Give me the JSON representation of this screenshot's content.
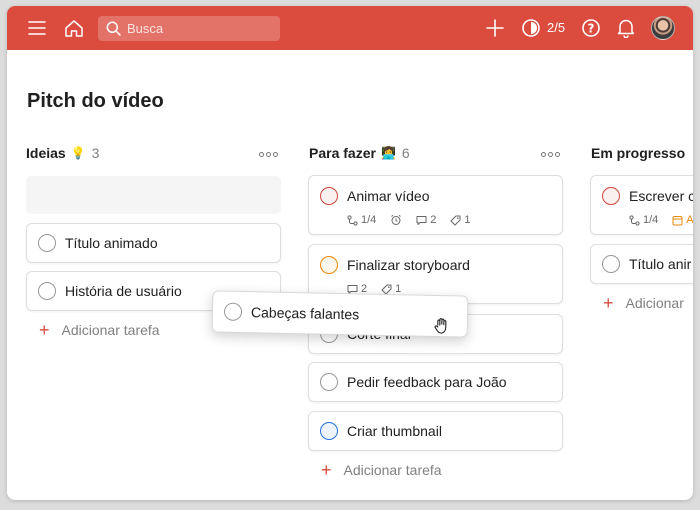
{
  "topbar": {
    "search_placeholder": "Busca",
    "karma": "2/5"
  },
  "project": {
    "title": "Pitch do vídeo"
  },
  "columns": [
    {
      "name": "Ideias",
      "emoji": "💡",
      "count": "3",
      "tasks": [
        {
          "title": "Título animado"
        },
        {
          "title": "História de usuário"
        }
      ],
      "add_label": "Adicionar tarefa"
    },
    {
      "name": "Para fazer",
      "emoji": "👩‍💻",
      "count": "6",
      "tasks": [
        {
          "title": "Animar vídeo",
          "priority": "red",
          "subtasks": "1/4",
          "comments": "2",
          "labels": "1"
        },
        {
          "title": "Finalizar storyboard",
          "priority": "orange",
          "comments": "2",
          "labels": "1"
        },
        {
          "title": "Corte final"
        },
        {
          "title": "Pedir feedback para João"
        },
        {
          "title": "Criar thumbnail",
          "priority": "blue"
        }
      ],
      "add_label": "Adicionar tarefa"
    },
    {
      "name": "Em progresso",
      "tasks": [
        {
          "title": "Escrever c",
          "priority": "red",
          "subtasks": "1/4",
          "date": "An"
        },
        {
          "title": "Título anir"
        }
      ],
      "add_label": "Adicionar"
    }
  ],
  "dragging_task": {
    "title": "Cabeças falantes"
  },
  "colors": {
    "brand": "#db4c3f",
    "priority_red": "#d1453b",
    "priority_orange": "#eb8909",
    "priority_blue": "#246fe0"
  }
}
